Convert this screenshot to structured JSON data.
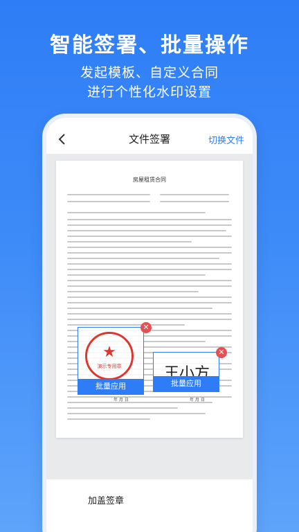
{
  "hero": {
    "title": "智能签署、批量操作",
    "subtitle_line1": "发起模板、自定义合同",
    "subtitle_line2": "进行个性化水印设置"
  },
  "app": {
    "title": "文件签署",
    "switch_label": "切换文件",
    "bottom_label": "加盖签章"
  },
  "document": {
    "title": "房屋租赁合同"
  },
  "stamps": [
    {
      "apply_label": "批量应用",
      "seal_text": "演示专用章",
      "date_text": "年  月  日"
    },
    {
      "apply_label": "批量应用",
      "signature_text": "王小方",
      "date_text": "年  月  日"
    }
  ],
  "colors": {
    "accent": "#2f7df6",
    "seal_red": "#e0352e",
    "delete_red": "#e65050"
  }
}
